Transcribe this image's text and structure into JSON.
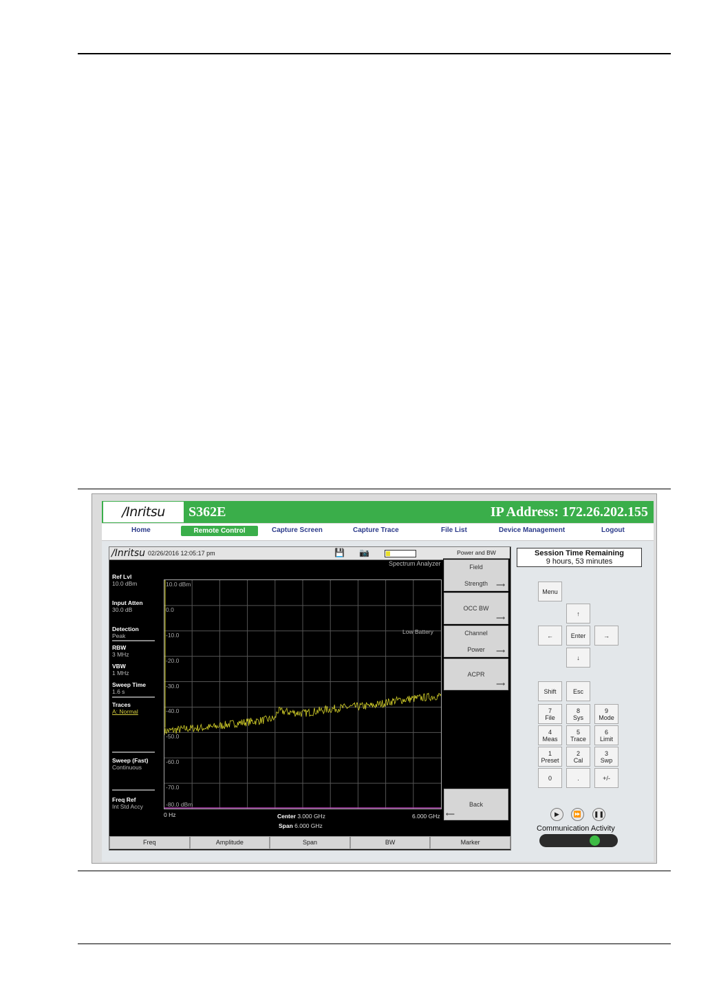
{
  "header": {
    "logo": "/Inritsu",
    "model": "S362E",
    "ip_address": "IP Address: 172.26.202.155"
  },
  "nav": {
    "home": "Home",
    "remote_control": "Remote Control",
    "capture_screen": "Capture Screen",
    "capture_trace": "Capture Trace",
    "file_list": "File List",
    "device_management": "Device Management",
    "logout": "Logout"
  },
  "instrument": {
    "logo": "/Inritsu",
    "datetime": "02/26/2016 12:05:17 pm",
    "mode_label": "Spectrum Analyzer",
    "low_battery": "Low Battery",
    "battery_level": 0.15,
    "left_panel": {
      "ref_lvl_label": "Ref Lvl",
      "ref_lvl_value": "10.0 dBm",
      "input_atten_label": "Input Atten",
      "input_atten_value": "30.0 dB",
      "detection_label": "Detection",
      "detection_value": "Peak",
      "rbw_label": "RBW",
      "rbw_value": "3 MHz",
      "vbw_label": "VBW",
      "vbw_value": "1 MHz",
      "sweep_time_label": "Sweep Time",
      "sweep_time_value": "1.6 s",
      "traces_label": "Traces",
      "traces_value": "A: Normal",
      "sweep_label": "Sweep (Fast)",
      "sweep_value": "Continuous",
      "freq_ref_label": "Freq Ref",
      "freq_ref_value": "Int Std Accy"
    },
    "softkeys": {
      "title": "Power and BW",
      "field_strength_1": "Field",
      "field_strength_2": "Strength",
      "occ_bw": "OCC BW",
      "channel_power_1": "Channel",
      "channel_power_2": "Power",
      "acpr": "ACPR",
      "back": "Back"
    },
    "bottom_keys": {
      "freq": "Freq",
      "amplitude": "Amplitude",
      "span": "Span",
      "bw": "BW",
      "marker": "Marker"
    },
    "x_footer": {
      "start": "0 Hz",
      "center_label": "Center",
      "center_value": "3.000 GHz",
      "span_label": "Span",
      "span_value": "6.000 GHz",
      "stop": "6.000 GHz"
    }
  },
  "chart_data": {
    "type": "line",
    "title": "",
    "xlabel": "",
    "ylabel": "",
    "x_range_ghz": [
      0,
      6
    ],
    "ylim": [
      -80,
      10
    ],
    "y_tick_labels": [
      "10.0 dBm",
      "0.0",
      "-10.0",
      "-20.0",
      "-30.0",
      "-40.0",
      "-50.0",
      "-60.0",
      "-70.0",
      "-80.0 dBm"
    ],
    "grid": true,
    "series": [
      {
        "x": [
          0.0,
          0.5,
          1.0,
          1.5,
          2.0,
          2.4,
          2.45,
          3.0,
          3.5,
          4.0,
          4.5,
          5.0,
          5.5,
          6.0
        ],
        "y": [
          -49.5,
          -48.5,
          -48.0,
          -46.5,
          -45.5,
          -44.5,
          -41.5,
          -42.5,
          -41.0,
          -40.0,
          -39.5,
          -37.5,
          -36.5,
          -35.5
        ]
      }
    ],
    "trace_color": "#d8d42a"
  },
  "session": {
    "title": "Session Time Remaining",
    "value": "9 hours, 53 minutes"
  },
  "keypad": {
    "menu": "Menu",
    "up": "↑",
    "left": "←",
    "enter": "Enter",
    "right": "→",
    "down": "↓",
    "shift": "Shift",
    "esc": "Esc",
    "k7a": "7",
    "k7b": "File",
    "k8a": "8",
    "k8b": "Sys",
    "k9a": "9",
    "k9b": "Mode",
    "k4a": "4",
    "k4b": "Meas",
    "k5a": "5",
    "k5b": "Trace",
    "k6a": "6",
    "k6b": "Limit",
    "k1a": "1",
    "k1b": "Preset",
    "k2a": "2",
    "k2b": "Cal",
    "k3a": "3",
    "k3b": "Swp",
    "k0": "0",
    "dot": ".",
    "plusminus": "+/-"
  },
  "comm": {
    "label": "Communication Activity"
  }
}
